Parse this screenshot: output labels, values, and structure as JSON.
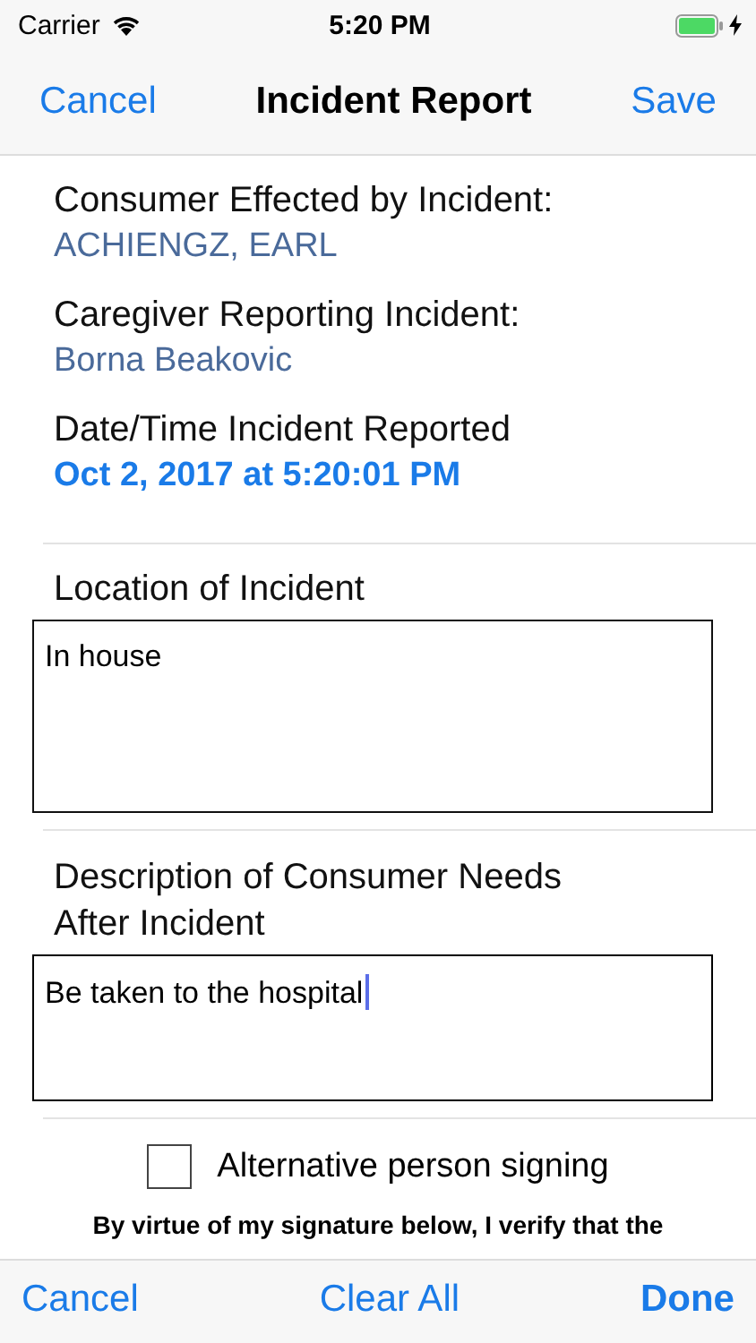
{
  "status_bar": {
    "carrier": "Carrier",
    "time": "5:20 PM",
    "charging": true
  },
  "nav_bar": {
    "left": "Cancel",
    "title": "Incident Report",
    "right": "Save"
  },
  "info": [
    {
      "label": "Consumer Effected by Incident:",
      "value": "ACHIENGZ, EARL",
      "kind": "plain"
    },
    {
      "label": "Caregiver Reporting Incident:",
      "value": "Borna Beakovic",
      "kind": "plain"
    },
    {
      "label": "Date/Time Incident Reported",
      "value": "Oct 2, 2017 at 5:20:01 PM",
      "kind": "date"
    }
  ],
  "fields": [
    {
      "label": "Location of Incident",
      "value": "In house",
      "focused": false
    },
    {
      "label": "Description of Consumer Needs After Incident",
      "value": "Be taken to the hospital",
      "focused": true
    }
  ],
  "alternative_signer": {
    "label": "Alternative person signing",
    "checked": false
  },
  "disclaimer": "By virtue of my signature below, I verify that the",
  "toolbar": [
    "Cancel",
    "Clear All",
    "Done"
  ]
}
